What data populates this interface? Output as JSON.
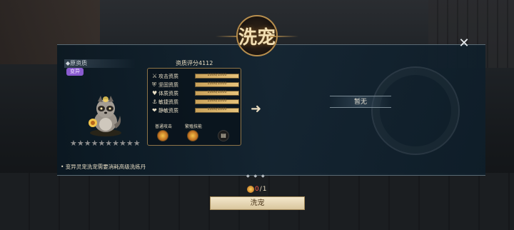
{
  "title": "洗宠",
  "close_icon": "close-icon",
  "pet_panel": {
    "origin_label": "◆原资质",
    "variant_badge": "变异",
    "pet_icon": "raccoon-pet-icon",
    "stars": "★★★★★★★★★★",
    "star_count_filled": 0,
    "star_count_total": 10
  },
  "score_label": "资质评分4112",
  "attributes": [
    {
      "icon": "sword-icon",
      "glyph": "⚔",
      "label": "攻击资质",
      "value": "1000/1000",
      "fill": 1.0
    },
    {
      "icon": "shield-icon",
      "glyph": "⛨",
      "label": "坚固资质",
      "value": "1000/1000",
      "fill": 1.0
    },
    {
      "icon": "heart-icon",
      "glyph": "♥",
      "label": "体质资质",
      "value": "1000/1000",
      "fill": 1.0
    },
    {
      "icon": "anchor-icon",
      "glyph": "⚓",
      "label": "敏捷资质",
      "value": "1000/1000",
      "fill": 1.0
    },
    {
      "icon": "heart-shield-icon",
      "glyph": "❤",
      "label": "静敏资质",
      "value": "1000/1000",
      "fill": 1.0
    }
  ],
  "skills": {
    "normal_attack_label": "普通攻击",
    "passive_label": "繁殖技能",
    "book_icon": "skill-book-icon"
  },
  "arrow_icon": "right-arrow-icon",
  "result_text": "暂无",
  "note": "• 变异灵宠洗宠需要消耗高级洗练丹",
  "cost": {
    "icon": "wash-pill-icon",
    "current": "0",
    "separator": "/",
    "total": "1"
  },
  "wash_button": "洗宠",
  "colors": {
    "accent_gold": "#caa25a",
    "variant_purple": "#8a5bd0",
    "cost_red": "#ff5a4a"
  }
}
